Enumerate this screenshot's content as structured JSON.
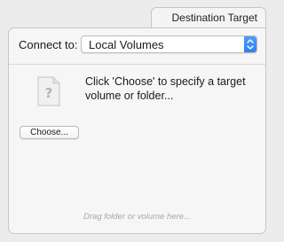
{
  "tab": {
    "label": "Destination Target"
  },
  "connect": {
    "label": "Connect to:",
    "selected_value": "Local Volumes"
  },
  "placeholder": {
    "icon": "generic-document-question-icon",
    "instruction": "Click 'Choose' to specify a target volume or folder..."
  },
  "choose_button": {
    "label": "Choose..."
  },
  "drop_hint": "Drag folder or volume here...",
  "colors": {
    "accent": "#3a8af5",
    "panel_bg": "#f6f6f6",
    "window_bg": "#ececec",
    "hint_text": "#a8a8a8"
  }
}
